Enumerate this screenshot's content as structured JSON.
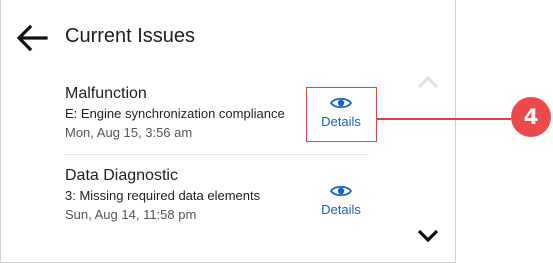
{
  "header": {
    "title": "Current Issues",
    "back_icon": "arrow-left-icon"
  },
  "issues": [
    {
      "title": "Malfunction",
      "description": "E: Engine synchronization compliance",
      "time": "Mon, Aug 15, 3:56 am",
      "action_label": "Details",
      "action_icon": "eye-icon"
    },
    {
      "title": "Data Diagnostic",
      "description": "3: Missing required data elements",
      "time": "Sun, Aug 14, 11:58 pm",
      "action_label": "Details",
      "action_icon": "eye-icon"
    }
  ],
  "scroll": {
    "up_icon": "chevron-up-icon",
    "down_icon": "chevron-down-icon"
  },
  "callout": {
    "number": "4",
    "color": "#ec4a4a"
  },
  "colors": {
    "accent": "#1565c0",
    "text": "#1f1f1f",
    "muted": "#555555",
    "highlight": "#e24040"
  }
}
